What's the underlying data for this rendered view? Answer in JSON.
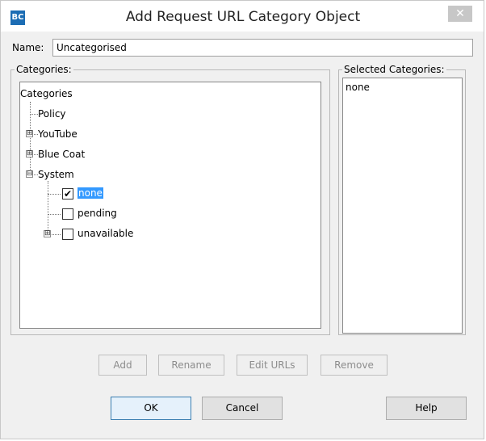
{
  "window": {
    "title": "Add Request URL Category Object",
    "app_icon_text": "BC",
    "close_glyph": "✕"
  },
  "name": {
    "label": "Name:",
    "value": "Uncategorised"
  },
  "categories_panel": {
    "legend": "Categories:",
    "root": "Categories",
    "items": {
      "policy": "Policy",
      "youtube": "YouTube",
      "blue_coat": "Blue Coat",
      "system": "System",
      "none": "none",
      "pending": "pending",
      "unavailable": "unavailable"
    },
    "checked": {
      "none": true,
      "pending": false,
      "unavailable": false
    }
  },
  "selected_panel": {
    "legend": "Selected Categories:",
    "items": [
      "none"
    ]
  },
  "actions": {
    "add": "Add",
    "rename": "Rename",
    "edit_urls": "Edit URLs",
    "remove": "Remove"
  },
  "dialog_buttons": {
    "ok": "OK",
    "cancel": "Cancel",
    "help": "Help"
  },
  "icons": {
    "expand": "⊞",
    "collapse": "⊟",
    "check": "✔"
  },
  "colors": {
    "selection": "#3399ff",
    "app_icon": "#1c6db4",
    "close_button": "#c7c7c7"
  }
}
